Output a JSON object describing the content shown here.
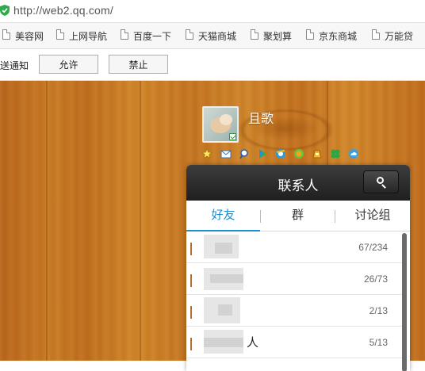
{
  "address_bar": {
    "url": "http://web2.qq.com/"
  },
  "bookmarks": [
    {
      "label": "美容网"
    },
    {
      "label": "上网导航"
    },
    {
      "label": "百度一下"
    },
    {
      "label": "天猫商城"
    },
    {
      "label": "聚划算"
    },
    {
      "label": "京东商城"
    },
    {
      "label": "万能贷"
    }
  ],
  "notification": {
    "text": "送通知",
    "allow_label": "允许",
    "deny_label": "禁止"
  },
  "profile": {
    "nickname": "且歌"
  },
  "app_icons": [
    "star-icon",
    "mail-icon",
    "search-app-icon",
    "play-icon",
    "browser-icon",
    "wallet-icon",
    "coin-bag-icon",
    "clover-icon",
    "cloud-icon"
  ],
  "contacts": {
    "title": "联系人",
    "tabs": [
      {
        "label": "好友",
        "active": true
      },
      {
        "label": "群",
        "active": false
      },
      {
        "label": "讨论组",
        "active": false
      }
    ],
    "groups": [
      {
        "name": "",
        "count": "67/234"
      },
      {
        "name": "",
        "count": "26/73"
      },
      {
        "name": "",
        "count": "2/13"
      },
      {
        "name": "人",
        "count": "5/13"
      }
    ]
  },
  "colors": {
    "accent": "#1a8fd6",
    "panel_title_bg": "#2b2b2b",
    "wood": "#c97a24"
  }
}
